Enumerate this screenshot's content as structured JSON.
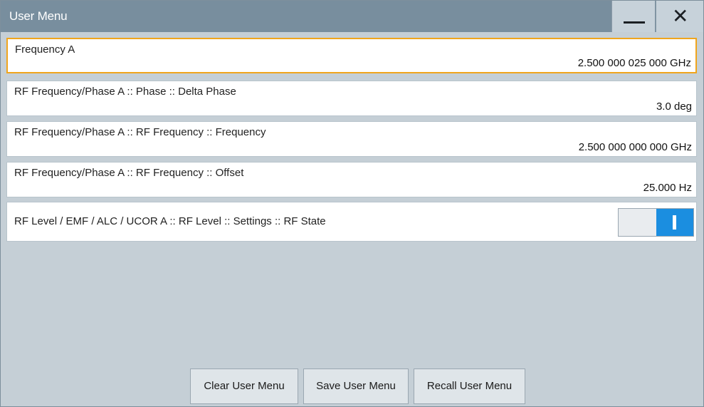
{
  "window": {
    "title": "User Menu",
    "minimize_icon": "minimize-icon",
    "close_glyph": "✕"
  },
  "rows": [
    {
      "label": "Frequency A",
      "value": "2.500 000 025 000 GHz",
      "selected": true
    },
    {
      "label": "RF Frequency/Phase A :: Phase :: Delta Phase",
      "value": "3.0 deg"
    },
    {
      "label": "RF Frequency/Phase A :: RF Frequency :: Frequency",
      "value": "2.500 000 000 000 GHz"
    },
    {
      "label": "RF Frequency/Phase A :: RF Frequency :: Offset",
      "value": "25.000 Hz"
    }
  ],
  "toggle_row": {
    "label": "RF Level / EMF / ALC / UCOR A :: RF Level :: Settings :: RF State",
    "state": "on"
  },
  "buttons": {
    "clear": "Clear User Menu",
    "save": "Save User Menu",
    "recall": "Recall User Menu"
  },
  "colors": {
    "titlebar": "#788e9e",
    "selection_border": "#f0a51d",
    "toggle_on": "#1b8ee0",
    "background": "#c5cfd6"
  }
}
